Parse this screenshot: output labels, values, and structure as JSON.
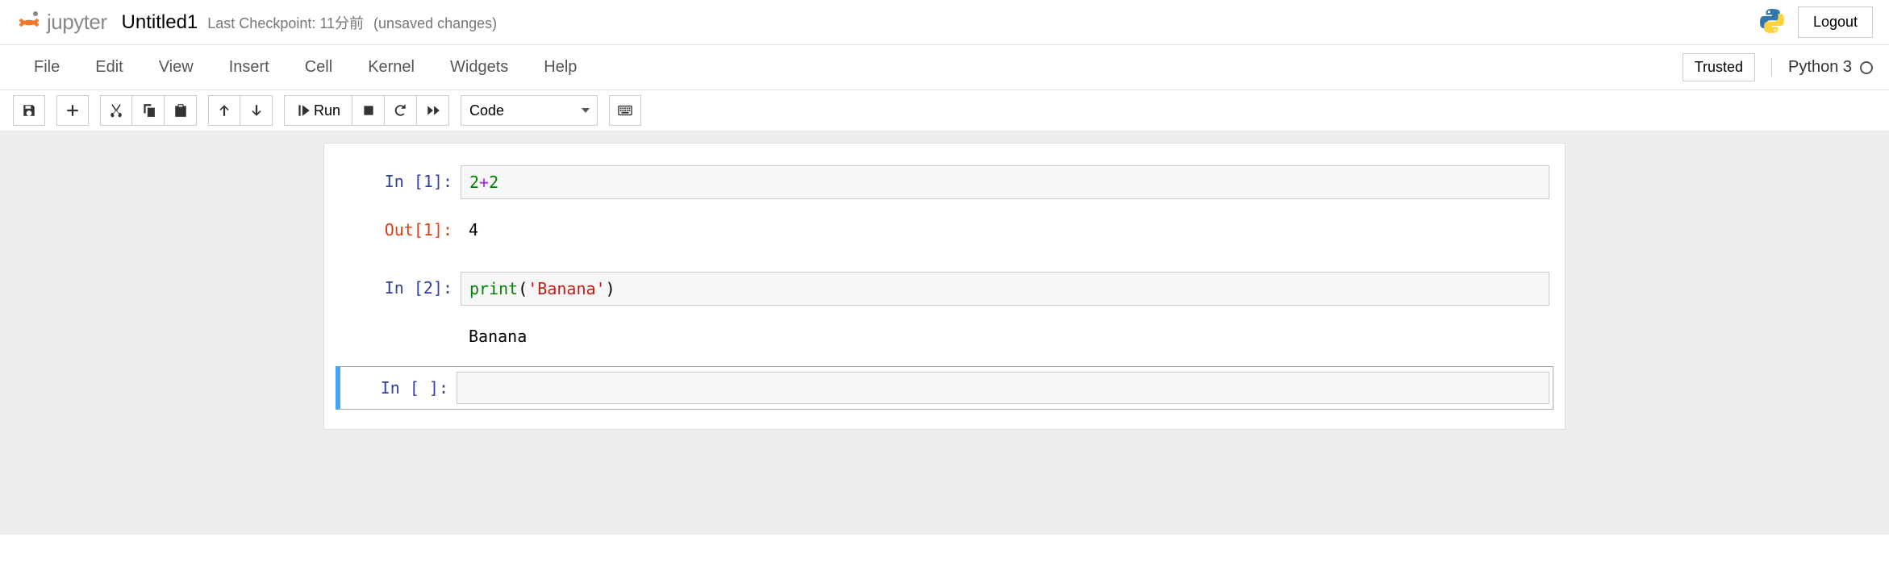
{
  "header": {
    "brand": "jupyter",
    "title": "Untitled1",
    "checkpoint_label": "Last Checkpoint: 11分前",
    "unsaved_label": "(unsaved changes)",
    "logout_label": "Logout"
  },
  "menu": {
    "items": [
      "File",
      "Edit",
      "View",
      "Insert",
      "Cell",
      "Kernel",
      "Widgets",
      "Help"
    ],
    "trusted_label": "Trusted",
    "kernel_label": "Python 3"
  },
  "toolbar": {
    "run_label": "Run",
    "celltype_selected": "Code"
  },
  "cells": [
    {
      "in_prompt": "In [1]:",
      "code_tokens": {
        "a": "2",
        "op": "+",
        "b": "2"
      },
      "out_prompt": "Out[1]:",
      "output": "4"
    },
    {
      "in_prompt": "In [2]:",
      "code_tokens": {
        "func": "print",
        "paren_open": "(",
        "str": "'Banana'",
        "paren_close": ")"
      },
      "stdout": "Banana"
    },
    {
      "in_prompt": "In [ ]:",
      "code": ""
    }
  ]
}
